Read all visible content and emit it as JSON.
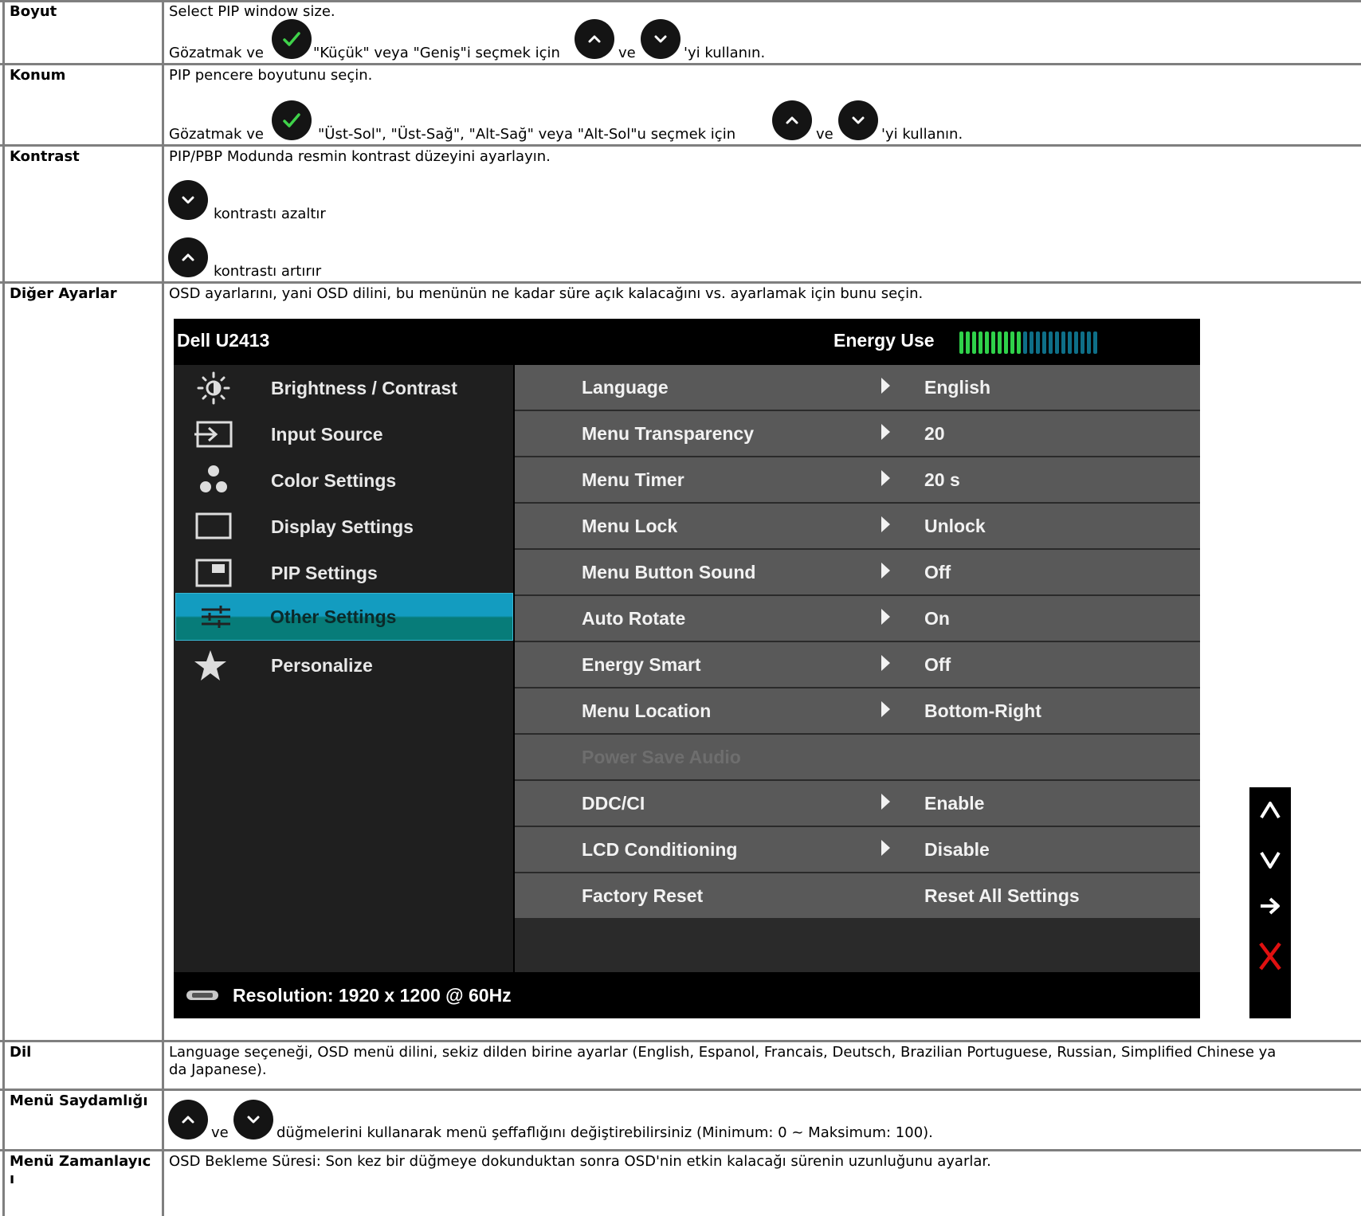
{
  "rows": {
    "boyut": {
      "label": "Boyut",
      "line1": "Select PIP window size.",
      "line2_a": "Gözatmak ve",
      "line2_b": "\"Küçük\" veya \"Geniş\"i seçmek için",
      "line2_c": "ve",
      "line2_d": "'yi kullanın."
    },
    "konum": {
      "label": "Konum",
      "line1": "PIP pencere boyutunu seçin.",
      "line2_a": "Gözatmak ve",
      "line2_b": "\"Üst-Sol\", \"Üst-Sağ\", \"Alt-Sağ\" veya \"Alt-Sol\"u seçmek için",
      "line2_c": "ve",
      "line2_d": "'yi kullanın."
    },
    "kontrast": {
      "label": "Kontrast",
      "line1": "PIP/PBP Modunda resmin kontrast düzeyini ayarlayın.",
      "down_text": "kontrastı azaltır",
      "up_text": "kontrastı artırır"
    },
    "diger": {
      "label": "Diğer Ayarlar",
      "line1": "OSD ayarlarını, yani OSD dilini, bu menünün ne kadar süre açık kalacağını vs. ayarlamak için bunu seçin."
    },
    "dil": {
      "label": "Dil",
      "line1": "Language seçeneği, OSD menü dilini, sekiz dilden birine ayarlar (English, Espanol, Francais, Deutsch, Brazilian Portuguese, Russian, Simplified Chinese ya",
      "line2": "da Japanese)."
    },
    "saydamlik": {
      "label": "Menü Saydamlığı",
      "text_a": "ve",
      "text_b": "düğmelerini kullanarak menü şeffaflığını değiştirebilirsiniz (Minimum: 0 ~ Maksimum: 100)."
    },
    "zamanlayici": {
      "label_1": "Menü Zamanlayıc",
      "label_2": "ı",
      "line1": "OSD Bekleme Süresi: Son kez bir düğmeye dokunduktan sonra OSD'nin etkin kalacağı sürenin uzunluğunu ayarlar."
    }
  },
  "osd": {
    "title": "Dell U2413",
    "energy_label": "Energy Use",
    "energy_level": 0.45,
    "menu": [
      {
        "label": "Brightness / Contrast",
        "icon": "brightness-icon"
      },
      {
        "label": "Input Source",
        "icon": "input-source-icon"
      },
      {
        "label": "Color Settings",
        "icon": "color-settings-icon"
      },
      {
        "label": "Display Settings",
        "icon": "display-settings-icon"
      },
      {
        "label": "PIP Settings",
        "icon": "pip-settings-icon"
      },
      {
        "label": "Other Settings",
        "icon": "other-settings-icon",
        "selected": true
      },
      {
        "label": "Personalize",
        "icon": "star-icon"
      }
    ],
    "options": [
      {
        "name": "Language",
        "value": "English",
        "arrow": true
      },
      {
        "name": "Menu Transparency",
        "value": "20",
        "arrow": true
      },
      {
        "name": "Menu Timer",
        "value": "20 s",
        "arrow": true
      },
      {
        "name": "Menu Lock",
        "value": "Unlock",
        "arrow": true
      },
      {
        "name": "Menu Button Sound",
        "value": "Off",
        "arrow": true
      },
      {
        "name": "Auto Rotate",
        "value": "On",
        "arrow": true
      },
      {
        "name": "Energy Smart",
        "value": "Off",
        "arrow": true
      },
      {
        "name": "Menu Location",
        "value": "Bottom-Right",
        "arrow": true
      },
      {
        "name": "Power Save Audio",
        "value": "",
        "arrow": false,
        "disabled": true
      },
      {
        "name": "DDC/CI",
        "value": "Enable",
        "arrow": true
      },
      {
        "name": "LCD Conditioning",
        "value": "Disable",
        "arrow": true
      },
      {
        "name": "Factory Reset",
        "value": "Reset All Settings",
        "arrow": false
      }
    ],
    "resolution": "Resolution: 1920 x 1200 @ 60Hz",
    "nav_buttons": [
      "up-icon",
      "down-icon",
      "enter-arrow-icon",
      "close-x-icon"
    ],
    "colors": {
      "meter_on": "#2fd14a",
      "meter_off": "#0e6f88",
      "selected_top": "#139cc0",
      "selected_bottom": "#077c79",
      "close_x": "#e01010"
    }
  }
}
